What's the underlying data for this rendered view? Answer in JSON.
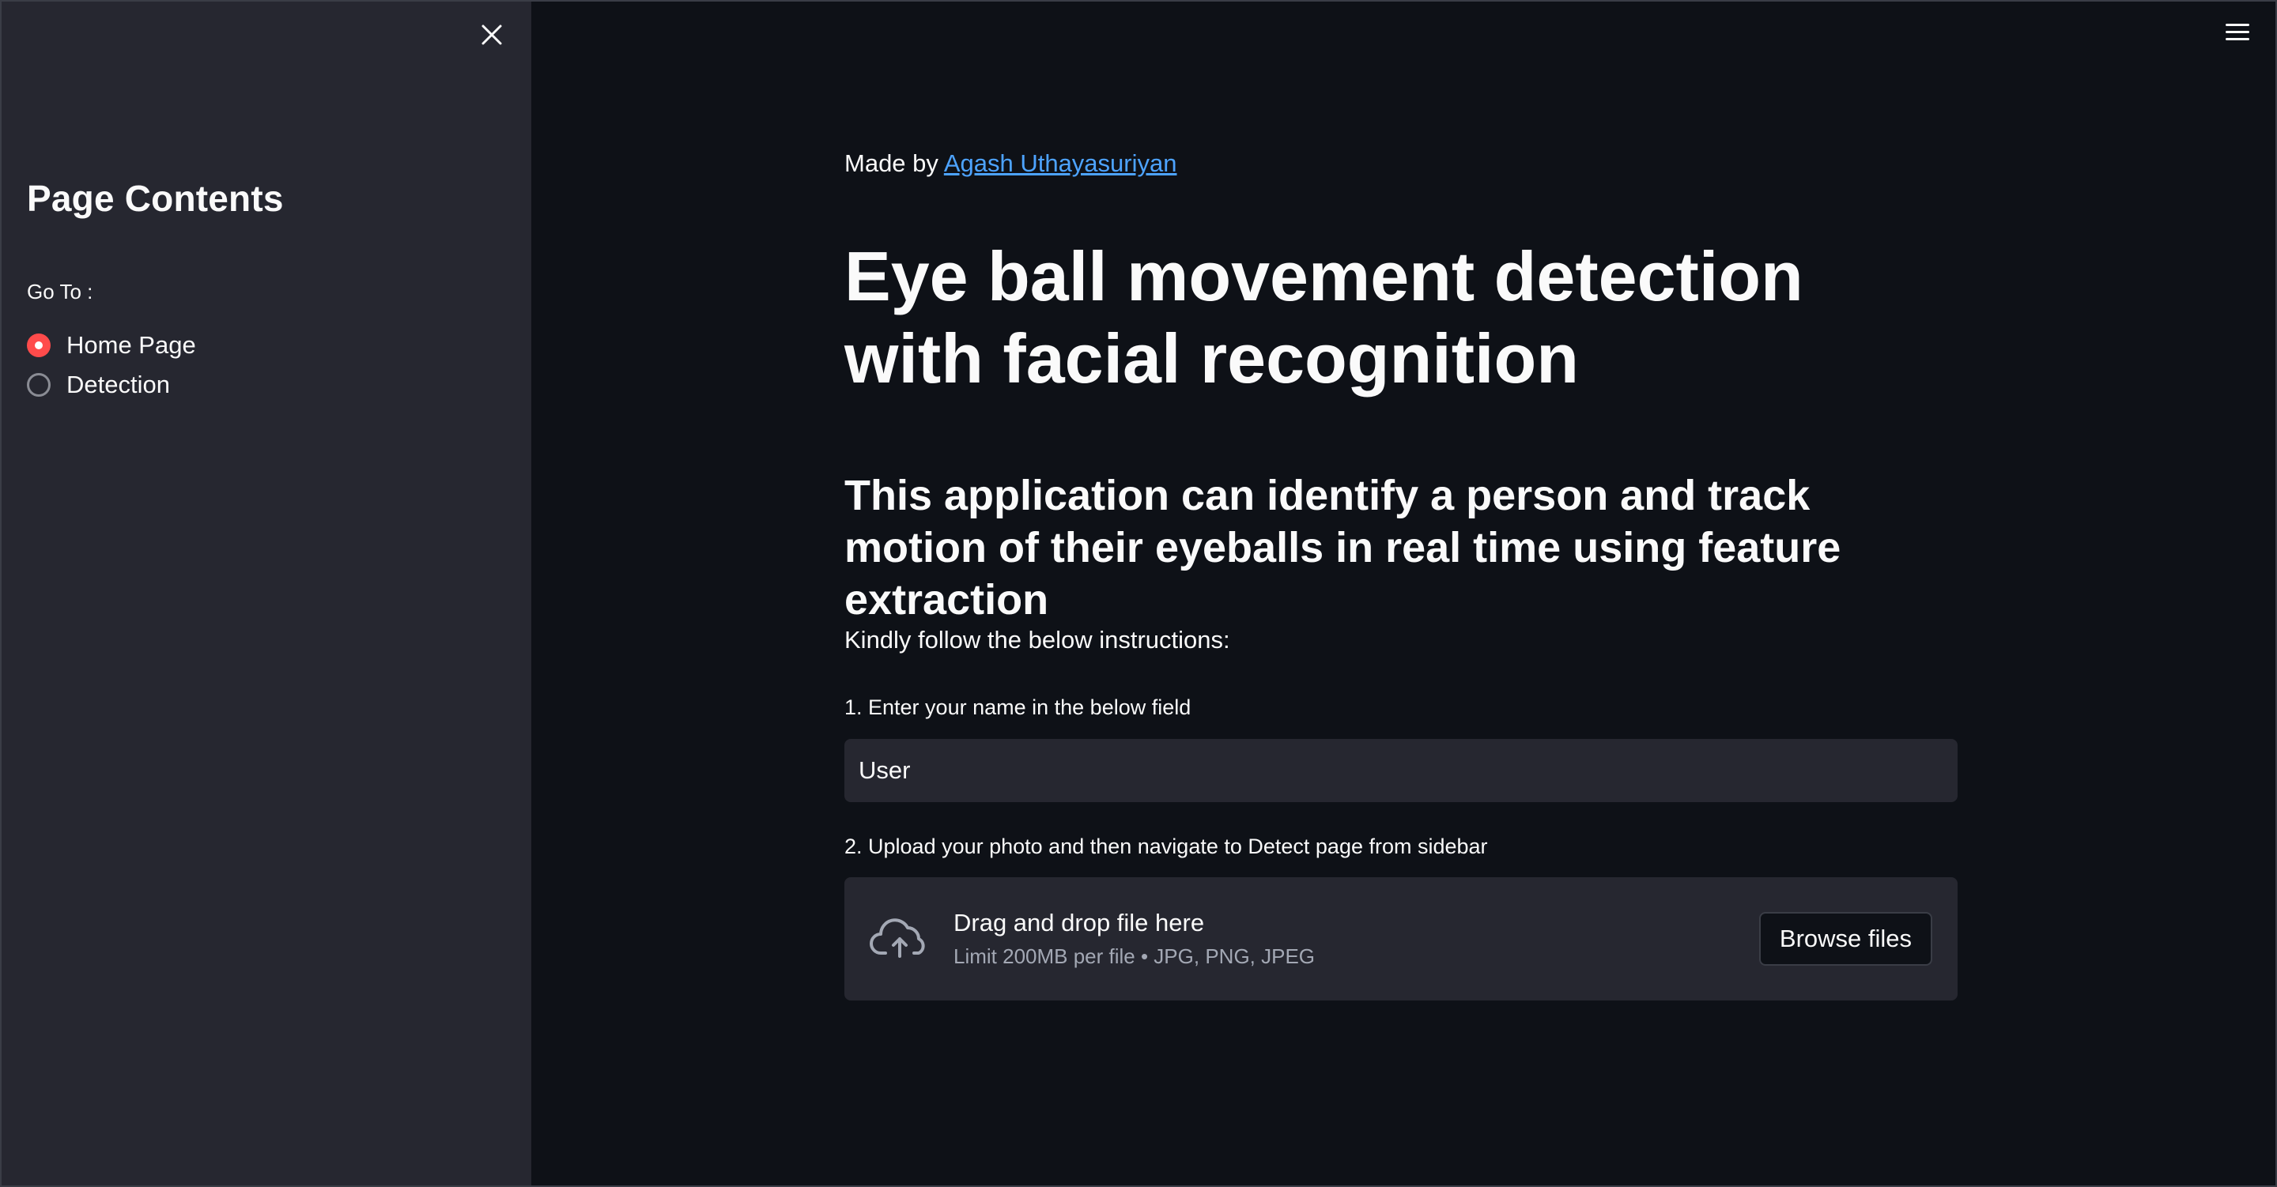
{
  "sidebar": {
    "title": "Page Contents",
    "goto_label": "Go To :",
    "options": [
      {
        "label": "Home Page",
        "selected": true
      },
      {
        "label": "Detection",
        "selected": false
      }
    ],
    "close_icon": "close-icon"
  },
  "header": {
    "menu_icon": "hamburger-menu-icon"
  },
  "main": {
    "made_by_prefix": "Made by ",
    "author_link": "Agash Uthayasuriyan",
    "title": "Eye ball movement detection with facial recognition",
    "subtitle": "This application can identify a person and track motion of their eyeballs in real time using feature extraction",
    "instructions": "Kindly follow the below instructions:",
    "step1": "1. Enter your name in the below field",
    "name_value": "User",
    "step2": "2. Upload your photo and then navigate to Detect page from sidebar",
    "uploader": {
      "main_text": "Drag and drop file here",
      "limit_text": "Limit 200MB per file • JPG, PNG, JPEG",
      "button_label": "Browse files",
      "icon": "cloud-upload-icon"
    }
  },
  "colors": {
    "background": "#0e1117",
    "sidebar": "#262730",
    "accent": "#ff4b4b",
    "link": "#4da3ff"
  }
}
